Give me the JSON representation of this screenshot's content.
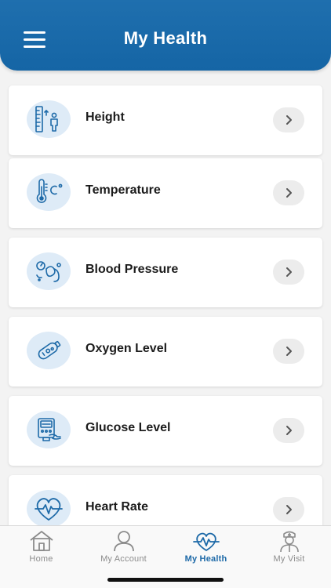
{
  "header": {
    "title": "My Health"
  },
  "colors": {
    "header_blue": "#1565a5",
    "icon_blue": "#1e6aa8",
    "icon_bg": "#deebf7",
    "active_tab": "#1e6aa8"
  },
  "items": [
    {
      "label": "Height",
      "icon": "height-icon"
    },
    {
      "label": "Temperature",
      "icon": "thermometer-icon"
    },
    {
      "label": "Blood Pressure",
      "icon": "blood-pressure-icon"
    },
    {
      "label": "Oxygen Level",
      "icon": "oxygen-icon"
    },
    {
      "label": "Glucose Level",
      "icon": "glucose-meter-icon"
    },
    {
      "label": "Heart Rate",
      "icon": "heart-rate-icon"
    }
  ],
  "tabs": [
    {
      "label": "Home",
      "icon": "home-icon",
      "active": false
    },
    {
      "label": "My Account",
      "icon": "account-icon",
      "active": false
    },
    {
      "label": "My Health",
      "icon": "heart-pulse-icon",
      "active": true
    },
    {
      "label": "My Visit",
      "icon": "nurse-icon",
      "active": false
    }
  ]
}
